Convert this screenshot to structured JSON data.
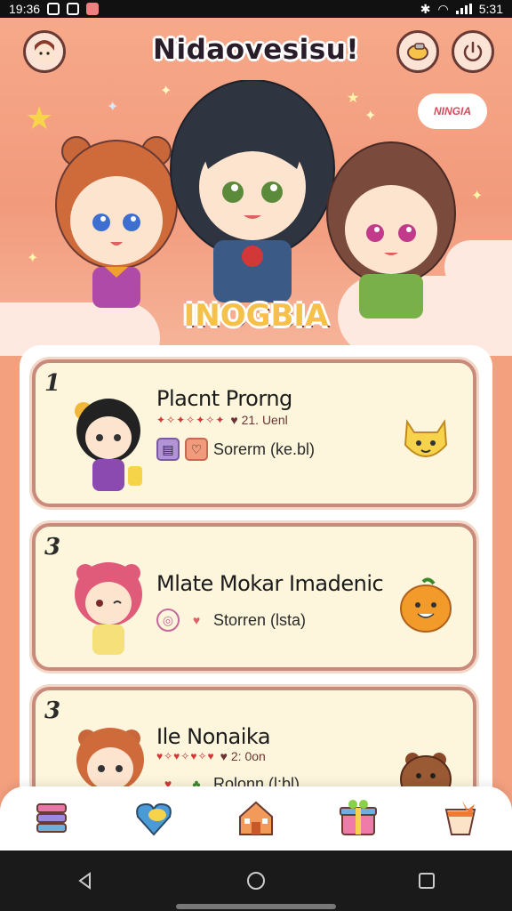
{
  "status_bar": {
    "time": "19:36",
    "battery": "5:31"
  },
  "header": {
    "title": "Nidaovesisu!",
    "speech_bubble": "NINGIA",
    "group_name": "INOGBIA"
  },
  "list": [
    {
      "rank": "1",
      "title": "Placnt Prorng",
      "subline": "♥ 21. Uenl",
      "tag_text": "Sorerm (ke.bl)",
      "tag_icons": [
        "book-icon",
        "heart-icon"
      ],
      "mascot": "cat-mascot"
    },
    {
      "rank": "3",
      "title": "Mlate Mokar Imadenic",
      "subline": "",
      "tag_text": "Storren (lsta)",
      "tag_icons": [
        "ring-icon",
        "paw-icon"
      ],
      "mascot": "orange-mascot"
    },
    {
      "rank": "3",
      "title": "Ile Nonaika",
      "subline": "♥ 2: 0on",
      "tag_text": "Rolonn (l:bl)",
      "tag_icons": [
        "heart-icon",
        "leaf-icon"
      ],
      "mascot": "bear-mascot"
    }
  ],
  "bottom_nav": [
    "stack-icon",
    "heart-icon",
    "house-icon",
    "gift-icon",
    "cup-icon"
  ],
  "colors": {
    "accent": "#f29a7c",
    "card_bg": "#fdf6dc",
    "card_border": "#c98a7c",
    "title_yellow": "#f5c14a"
  }
}
